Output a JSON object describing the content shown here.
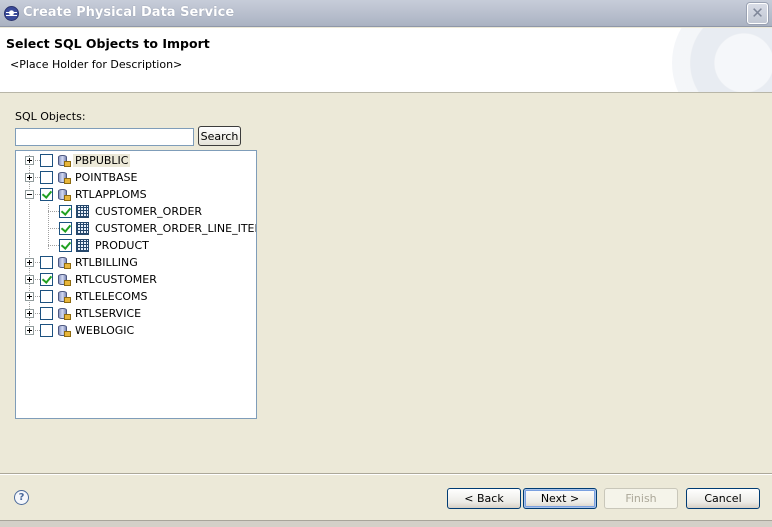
{
  "window": {
    "title": "Create Physical Data Service",
    "close_glyph": "✕"
  },
  "header": {
    "title": "Select SQL Objects to Import",
    "description": "<Place Holder for Description>"
  },
  "sql_objects": {
    "label": "SQL Objects:",
    "search_value": "",
    "search_button": "Search"
  },
  "tree": {
    "nodes": [
      {
        "label": "PBPUBLIC",
        "type": "schema",
        "expanded": false,
        "checked": false,
        "selected": true
      },
      {
        "label": "POINTBASE",
        "type": "schema",
        "expanded": false,
        "checked": false
      },
      {
        "label": "RTLAPPLOMS",
        "type": "schema",
        "expanded": true,
        "checked": true,
        "children": [
          {
            "label": "CUSTOMER_ORDER",
            "type": "table",
            "checked": true
          },
          {
            "label": "CUSTOMER_ORDER_LINE_ITEM",
            "type": "table",
            "checked": true
          },
          {
            "label": "PRODUCT",
            "type": "table",
            "checked": true
          }
        ]
      },
      {
        "label": "RTLBILLING",
        "type": "schema",
        "expanded": false,
        "checked": false
      },
      {
        "label": "RTLCUSTOMER",
        "type": "schema",
        "expanded": false,
        "checked": true
      },
      {
        "label": "RTLELECOMS",
        "type": "schema",
        "expanded": false,
        "checked": false
      },
      {
        "label": "RTLSERVICE",
        "type": "schema",
        "expanded": false,
        "checked": false
      },
      {
        "label": "WEBLOGIC",
        "type": "schema",
        "expanded": false,
        "checked": false
      }
    ]
  },
  "footer": {
    "help_glyph": "?",
    "back": "< Back",
    "next": "Next >",
    "finish": "Finish",
    "cancel": "Cancel"
  }
}
